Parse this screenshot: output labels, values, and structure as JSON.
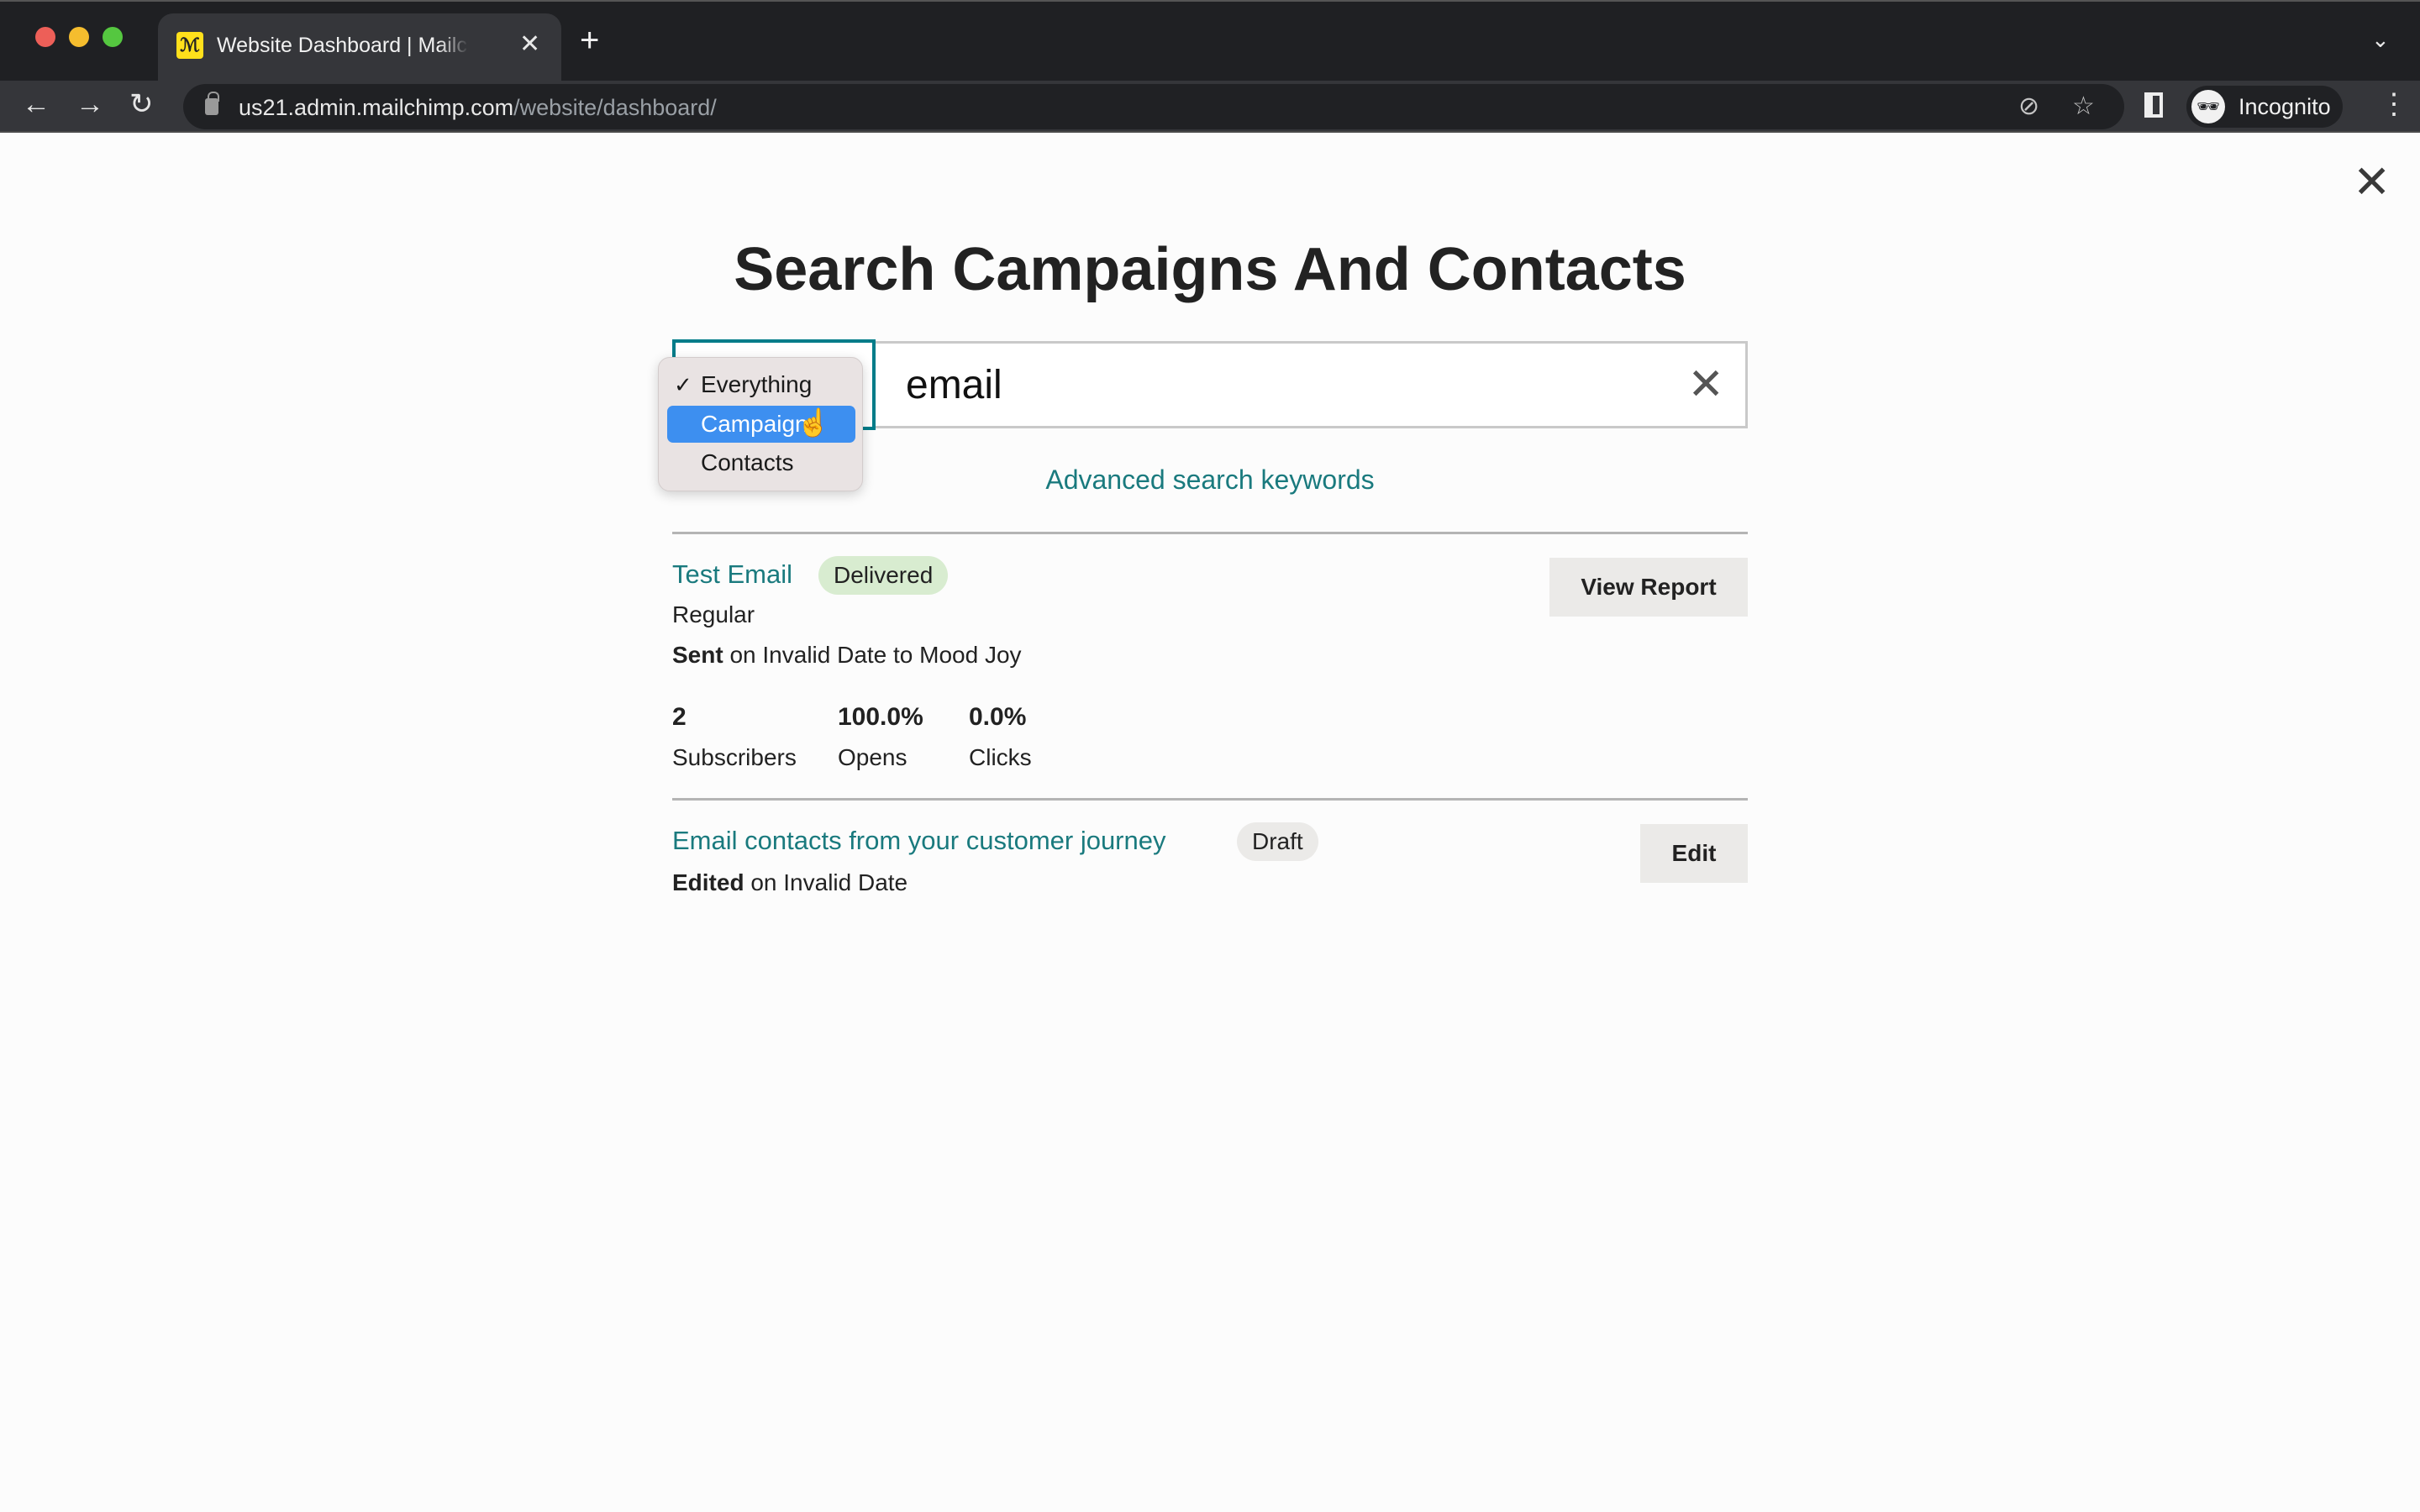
{
  "browser": {
    "tab_title": "Website Dashboard | Mailchimp",
    "tab_favicon": "mailchimp-freddie-icon",
    "new_tab_symbol": "+",
    "tab_close_symbol": "✕",
    "tab_menu_symbol": "⌄",
    "url_host": "us21.admin.mailchimp.com",
    "url_path": "/website/dashboard/",
    "profile_label": "Incognito",
    "back_symbol": "←",
    "forward_symbol": "→",
    "reload_symbol": "↻",
    "eye_off_symbol": "⊘",
    "star_symbol": "☆",
    "kebab_symbol": "⋮",
    "incognito_symbol": "🕶"
  },
  "page": {
    "close_symbol": "✕",
    "title": "Search Campaigns And Contacts",
    "search": {
      "value": "email",
      "clear_symbol": "✕",
      "scope_selected": "Everything",
      "scope_options": [
        {
          "label": "Everything",
          "checked": true,
          "highlighted": false
        },
        {
          "label": "Campaigns",
          "checked": false,
          "highlighted": true
        },
        {
          "label": "Contacts",
          "checked": false,
          "highlighted": false
        }
      ],
      "check_symbol": "✓"
    },
    "advanced_link": "Advanced search keywords",
    "results": [
      {
        "title": "Test Email",
        "status": "Delivered",
        "type": "Regular",
        "meta_bold": "Sent",
        "meta_rest": " on Invalid Date to Mood Joy",
        "stats": [
          {
            "value": "2",
            "label": "Subscribers"
          },
          {
            "value": "100.0%",
            "label": "Opens"
          },
          {
            "value": "0.0%",
            "label": "Clicks"
          }
        ],
        "action": "View Report"
      },
      {
        "title": "Email contacts from your customer journey",
        "status": "Draft",
        "meta_bold": "Edited",
        "meta_rest": " on Invalid Date",
        "action": "Edit"
      }
    ]
  },
  "colors": {
    "accent_teal": "#007c89",
    "link_teal": "#1a7a7e",
    "delivered_badge": "#d8ecd0",
    "draft_badge": "#ebeae8",
    "highlight_blue": "#3d8ff0"
  }
}
